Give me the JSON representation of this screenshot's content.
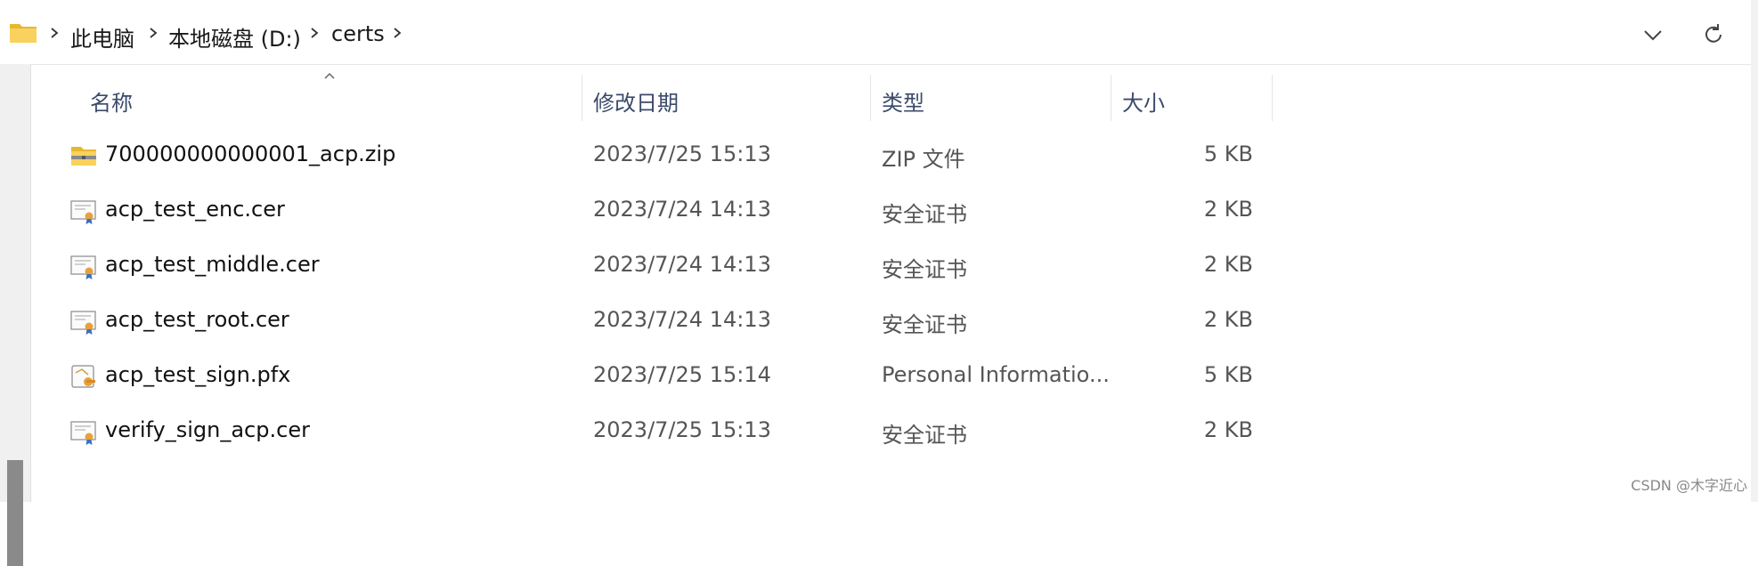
{
  "breadcrumb": {
    "items": [
      "此电脑",
      "本地磁盘 (D:)",
      "certs"
    ]
  },
  "columns": {
    "name": "名称",
    "modified": "修改日期",
    "type": "类型",
    "size": "大小"
  },
  "files": [
    {
      "name": "700000000000001_acp.zip",
      "modified": "2023/7/25 15:13",
      "type": "ZIP 文件",
      "size": "5 KB",
      "icon": "zip-folder-icon"
    },
    {
      "name": "acp_test_enc.cer",
      "modified": "2023/7/24 14:13",
      "type": "安全证书",
      "size": "2 KB",
      "icon": "certificate-icon"
    },
    {
      "name": "acp_test_middle.cer",
      "modified": "2023/7/24 14:13",
      "type": "安全证书",
      "size": "2 KB",
      "icon": "certificate-icon"
    },
    {
      "name": "acp_test_root.cer",
      "modified": "2023/7/24 14:13",
      "type": "安全证书",
      "size": "2 KB",
      "icon": "certificate-icon"
    },
    {
      "name": "acp_test_sign.pfx",
      "modified": "2023/7/25 15:14",
      "type": "Personal Informatio...",
      "size": "5 KB",
      "icon": "personal-info-exchange-icon"
    },
    {
      "name": "verify_sign_acp.cer",
      "modified": "2023/7/25 15:13",
      "type": "安全证书",
      "size": "2 KB",
      "icon": "certificate-icon"
    }
  ],
  "watermark": "CSDN @木字近心",
  "colors": {
    "folder_yellow": "#f4c542",
    "header_text": "#3b4a6b",
    "scroll_thumb": "#8a8a8a"
  }
}
